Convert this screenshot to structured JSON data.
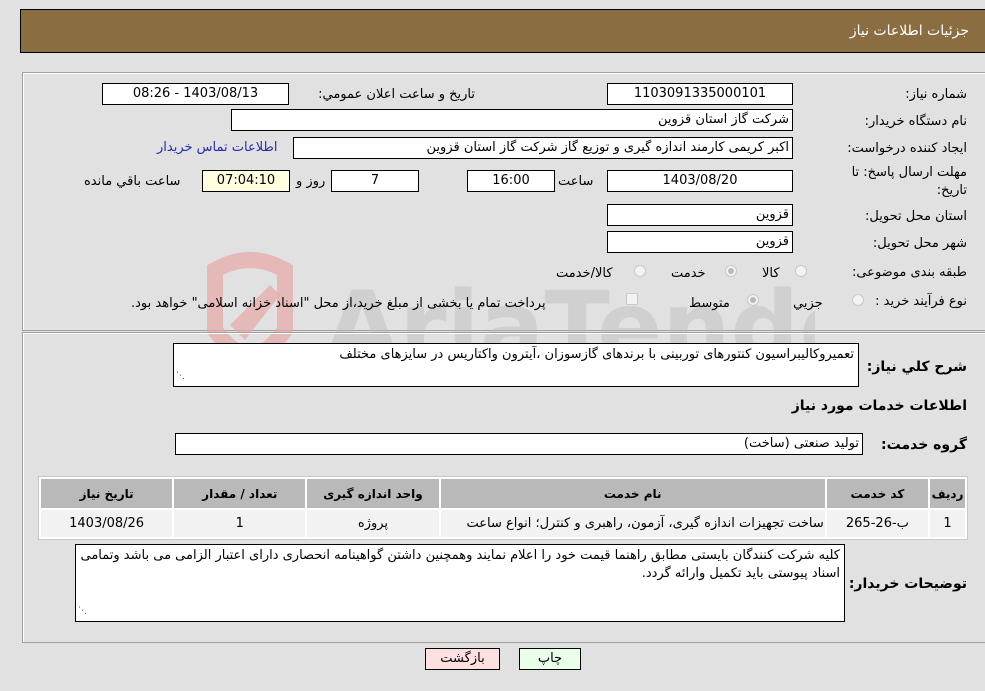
{
  "header": {
    "title": "جزئیات اطلاعات نیاز"
  },
  "fields": {
    "need_number": {
      "label": "شماره نیاز:",
      "value": "1103091335000101"
    },
    "announce_datetime": {
      "label": "تاریخ و ساعت اعلان عمومي:",
      "value": "1403/08/13 - 08:26"
    },
    "buyer_org": {
      "label": "نام دستگاه خریدار:",
      "value": "شرکت گاز استان قزوین"
    },
    "requester": {
      "label": "ایجاد کننده درخواست:",
      "value": "اکبر کریمی کارمند اندازه گیری و توزیع گاز شرکت گاز استان قزوین",
      "contact_link": "اطلاعات تماس خریدار"
    },
    "deadline": {
      "label_line1": "مهلت ارسال پاسخ: تا",
      "label_line2": "تاریخ:",
      "date": "1403/08/20",
      "time_label": "ساعت",
      "time": "16:00",
      "days": "7",
      "days_label": "روز و",
      "remaining": "07:04:10",
      "remaining_label": "ساعت باقي مانده"
    },
    "province": {
      "label": "استان محل تحویل:",
      "value": "قزوین"
    },
    "city": {
      "label": "شهر محل تحویل:",
      "value": "قزوین"
    },
    "category": {
      "label": "طبقه بندی موضوعی:",
      "options": [
        {
          "label": "کالا",
          "selected": false
        },
        {
          "label": "خدمت",
          "selected": true
        },
        {
          "label": "کالا/خدمت",
          "selected": false
        }
      ]
    },
    "purchase_type": {
      "label": "نوع فرآیند خرید :",
      "options": [
        {
          "label": "جزيي",
          "selected": false
        },
        {
          "label": "متوسط",
          "selected": true
        }
      ],
      "treasury_checkbox": {
        "label": "پرداخت تمام یا بخشی از مبلغ خرید،از محل \"اسناد خزانه اسلامی\" خواهد بود.",
        "checked": false
      }
    }
  },
  "description": {
    "label": "شرح کلي نیاز:",
    "value": "تعمیروکالیبراسیون کنتورهای توربینی با برندهای گازسوزان ،آیترون واکتاریس در سایزهای مختلف"
  },
  "services_section": {
    "title": "اطلاعات خدمات مورد نیاز"
  },
  "service_group": {
    "label": "گروه خدمت:",
    "value": "تولید صنعتی (ساخت)"
  },
  "table": {
    "headers": [
      "ردیف",
      "کد خدمت",
      "نام خدمت",
      "واحد اندازه گیری",
      "تعداد / مقدار",
      "تاریخ نیاز"
    ],
    "rows": [
      [
        "1",
        "ب-26-265",
        "ساخت تجهیزات اندازه گیری، آزمون، راهبری و کنترل؛ انواع ساعت",
        "پروژه",
        "1",
        "1403/08/26"
      ]
    ]
  },
  "buyer_notes": {
    "label": "توضیحات خریدار:",
    "value": "کلیه شرکت کنندگان بایستی مطابق راهنما قیمت خود را اعلام نمایند وهمچنین داشتن گواهینامه انحصاری دارای اعتبار الزامی می باشد وتمامی اسناد پیوستی باید تکمیل وارائه گردد."
  },
  "buttons": {
    "print": "چاپ",
    "back": "بازگشت"
  },
  "colors": {
    "header_bg": "#8b6d42",
    "print_bg": "#eaffea",
    "back_bg": "#ffe0e0",
    "link": "#2a2ab0"
  },
  "watermark": {
    "text": "AriaTender.neT"
  }
}
